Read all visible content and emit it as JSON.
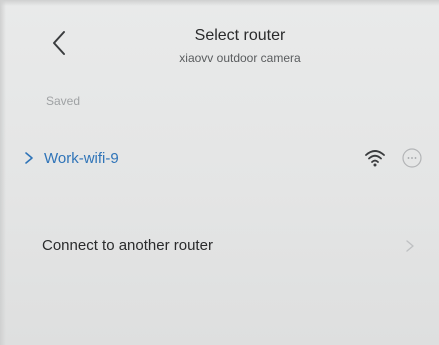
{
  "header": {
    "back_icon": "chevron-left-icon",
    "title": "Select router",
    "subtitle": "xiaovv outdoor camera"
  },
  "saved": {
    "label": "Saved",
    "networks": [
      {
        "name": "Work-wifi-9",
        "expand_icon": "chevron-right-icon",
        "signal_icon": "wifi-icon",
        "more_icon": "more-icon"
      }
    ]
  },
  "connect_other": {
    "label": "Connect to another router",
    "icon": "chevron-right-icon"
  },
  "colors": {
    "accent": "#2f74b8",
    "background": "#e6e7e7",
    "title_text": "#2a2b2c",
    "muted_text": "#9fa2a4"
  }
}
